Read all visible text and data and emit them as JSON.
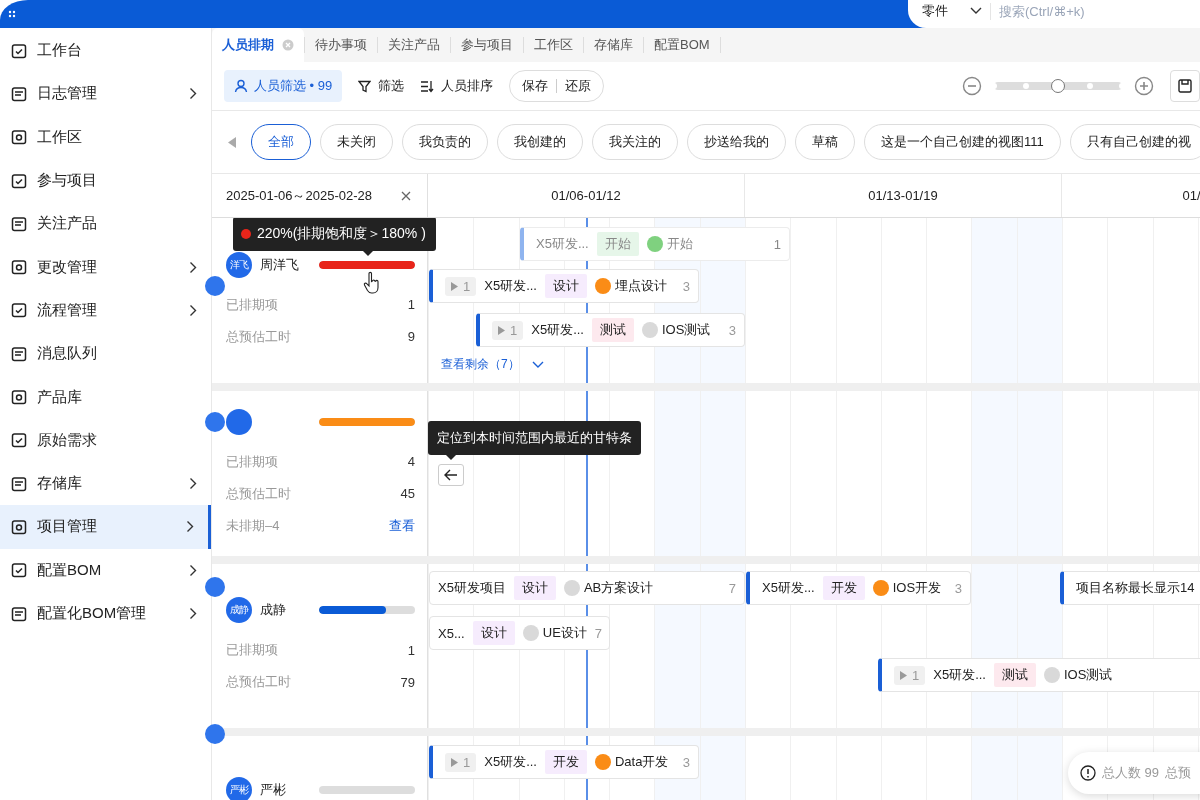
{
  "topbar": {
    "scope": "零件",
    "search": {
      "placeholder": "搜索(Ctrl/⌘+k)"
    }
  },
  "sidebar": {
    "items": [
      {
        "label": "工作台",
        "expandable": false,
        "selected": false
      },
      {
        "label": "日志管理",
        "expandable": true,
        "selected": false
      },
      {
        "label": "工作区",
        "expandable": false,
        "selected": false
      },
      {
        "label": "参与项目",
        "expandable": false,
        "selected": false
      },
      {
        "label": "关注产品",
        "expandable": false,
        "selected": false
      },
      {
        "label": "更改管理",
        "expandable": true,
        "selected": false
      },
      {
        "label": "流程管理",
        "expandable": true,
        "selected": false
      },
      {
        "label": "消息队列",
        "expandable": false,
        "selected": false
      },
      {
        "label": "产品库",
        "expandable": false,
        "selected": false
      },
      {
        "label": "原始需求",
        "expandable": false,
        "selected": false
      },
      {
        "label": "存储库",
        "expandable": true,
        "selected": false
      },
      {
        "label": "项目管理",
        "expandable": true,
        "selected": true
      },
      {
        "label": "配置BOM",
        "expandable": true,
        "selected": false
      },
      {
        "label": "配置化BOM管理",
        "expandable": true,
        "selected": false
      }
    ]
  },
  "tabs": [
    {
      "label": "人员排期",
      "selected": true,
      "closable": true
    },
    {
      "label": "待办事项",
      "selected": false,
      "closable": false
    },
    {
      "label": "关注产品",
      "selected": false,
      "closable": false
    },
    {
      "label": "参与项目",
      "selected": false,
      "closable": false
    },
    {
      "label": "工作区",
      "selected": false,
      "closable": false
    },
    {
      "label": "存储库",
      "selected": false,
      "closable": false
    },
    {
      "label": "配置BOM",
      "selected": false,
      "closable": false
    }
  ],
  "toolbar": {
    "people_filter": "人员筛选 • 99",
    "filter": "筛选",
    "sort": "人员排序",
    "save": "保存",
    "restore": "还原",
    "zoom": {
      "level": 0.5
    }
  },
  "views": [
    {
      "label": "全部",
      "selected": true
    },
    {
      "label": "未关闭",
      "selected": false
    },
    {
      "label": "我负责的",
      "selected": false
    },
    {
      "label": "我创建的",
      "selected": false
    },
    {
      "label": "我关注的",
      "selected": false
    },
    {
      "label": "抄送给我的",
      "selected": false
    },
    {
      "label": "草稿",
      "selected": false
    },
    {
      "label": "这是一个自己创建的视图111",
      "selected": false
    },
    {
      "label": "只有自己创建的视",
      "selected": false
    }
  ],
  "gantt": {
    "range": "2025-01-06～2025-02-28",
    "weeks": [
      "01/06-01/12",
      "01/13-01/19",
      "01/"
    ],
    "locate_tooltip": "定位到本时间范围内最近的甘特条",
    "people": [
      {
        "avatar": "洋飞",
        "name": "周洋飞",
        "load": {
          "level": 1,
          "color": "#e8251a"
        },
        "tooltip": {
          "text": "220%(排期饱和度＞180% )",
          "color": "#e8251a"
        },
        "stats": [
          {
            "label": "已排期项",
            "value": "1"
          },
          {
            "label": "总预估工时",
            "value": "9"
          }
        ],
        "more": "查看剩余（7）",
        "bars": [
          {
            "faded": true,
            "edge": true,
            "project": "X5研发...",
            "tag": {
              "text": "开始",
              "color": "#e6f6e9"
            },
            "status": {
              "color": "#7fd17f"
            },
            "task": "开始",
            "hours": "1"
          },
          {
            "faded": false,
            "edge": true,
            "count": "1",
            "project": "X5研发...",
            "tag": {
              "text": "设计",
              "color": "#f6ecfd"
            },
            "status": {
              "color": "#fa8c16"
            },
            "task": "埋点设计",
            "hours": "3"
          },
          {
            "faded": false,
            "edge": true,
            "count": "1",
            "project": "X5研发...",
            "tag": {
              "text": "测试",
              "color": "#fde9ee"
            },
            "status": {
              "color": "#d9d9d9"
            },
            "task": "IOS测试",
            "hours": "3"
          }
        ]
      },
      {
        "load": {
          "level": 1,
          "color": "#fa8c16"
        },
        "stats": [
          {
            "label": "已排期项",
            "value": "4"
          },
          {
            "label": "总预估工时",
            "value": "45"
          },
          {
            "label": "未排期–4",
            "link": "查看"
          }
        ]
      },
      {
        "avatar": "成静",
        "name": "成静",
        "load": {
          "level": 0.7,
          "color": "#0a5bd6"
        },
        "stats": [
          {
            "label": "已排期项",
            "value": "1"
          },
          {
            "label": "总预估工时",
            "value": "79"
          }
        ],
        "bars": [
          {
            "faded": false,
            "edge": false,
            "project": "X5研发项目",
            "tag": {
              "text": "设计",
              "color": "#f6ecfd"
            },
            "status": {
              "color": "#d9d9d9"
            },
            "task": "AB方案设计",
            "hours": "7"
          },
          {
            "faded": false,
            "edge": true,
            "project": "X5研发...",
            "tag": {
              "text": "开发",
              "color": "#f6ecfd"
            },
            "status": {
              "color": "#fa8c16"
            },
            "task": "IOS开发",
            "hours": "3"
          },
          {
            "faded": false,
            "edge": true,
            "project": "项目名称最长显示14"
          },
          {
            "faded": false,
            "edge": false,
            "project": "X5...",
            "tag": {
              "text": "设计",
              "color": "#f6ecfd"
            },
            "status": {
              "color": "#d9d9d9"
            },
            "task": "UE设计",
            "hours": "7"
          },
          {
            "faded": false,
            "edge": true,
            "count": "1",
            "project": "X5研发...",
            "tag": {
              "text": "测试",
              "color": "#fde9ee"
            },
            "status": {
              "color": "#d9d9d9"
            },
            "task": "IOS测试"
          }
        ]
      },
      {
        "avatar": "严彬",
        "name": "严彬",
        "bars": [
          {
            "faded": false,
            "edge": true,
            "count": "1",
            "project": "X5研发...",
            "tag": {
              "text": "开发",
              "color": "#f6ecfd"
            },
            "status": {
              "color": "#fa8c16"
            },
            "task": "Data开发",
            "hours": "3"
          }
        ]
      }
    ]
  },
  "summary": {
    "total": "总人数 99",
    "more": "总预"
  }
}
